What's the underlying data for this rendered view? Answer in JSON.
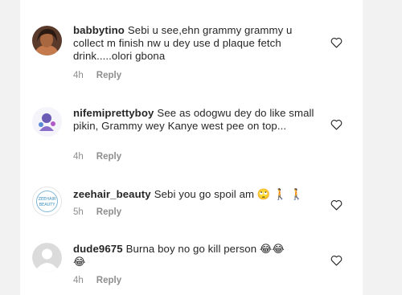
{
  "comments": [
    {
      "username": "babbytino",
      "text": "Sebi u see,ehn grammy grammy u collect m finish nw u dey use d plaque fetch drink.....olori gbona",
      "time": "4h",
      "reply_label": "Reply",
      "avatar_icon": "profile-photo-icon"
    },
    {
      "username": "nifemiprettyboy",
      "text": "See as odogwu dey do like small pikin, Grammy wey Kanye west pee on top...",
      "time": "4h",
      "reply_label": "Reply",
      "avatar_icon": "profile-photo-icon"
    },
    {
      "username": "zeehair_beauty",
      "text": "Sebi you go spoil am",
      "text_emoji": "🙄 🚶 🚶",
      "time": "5h",
      "reply_label": "Reply",
      "avatar_icon": "brand-logo-icon",
      "logo_text": "ZEEHAIR BEAUTY"
    },
    {
      "username": "dude9675",
      "text": "Burna boy no go kill person",
      "text_emoji": "😂😂",
      "text_emoji_line2": "😂",
      "time": "4h",
      "reply_label": "Reply",
      "avatar_icon": "default-avatar-icon"
    }
  ],
  "icons": {
    "like": "heart-outline-icon"
  },
  "colors": {
    "text": "#262626",
    "meta": "#8e8e8e",
    "border": "#262626"
  }
}
